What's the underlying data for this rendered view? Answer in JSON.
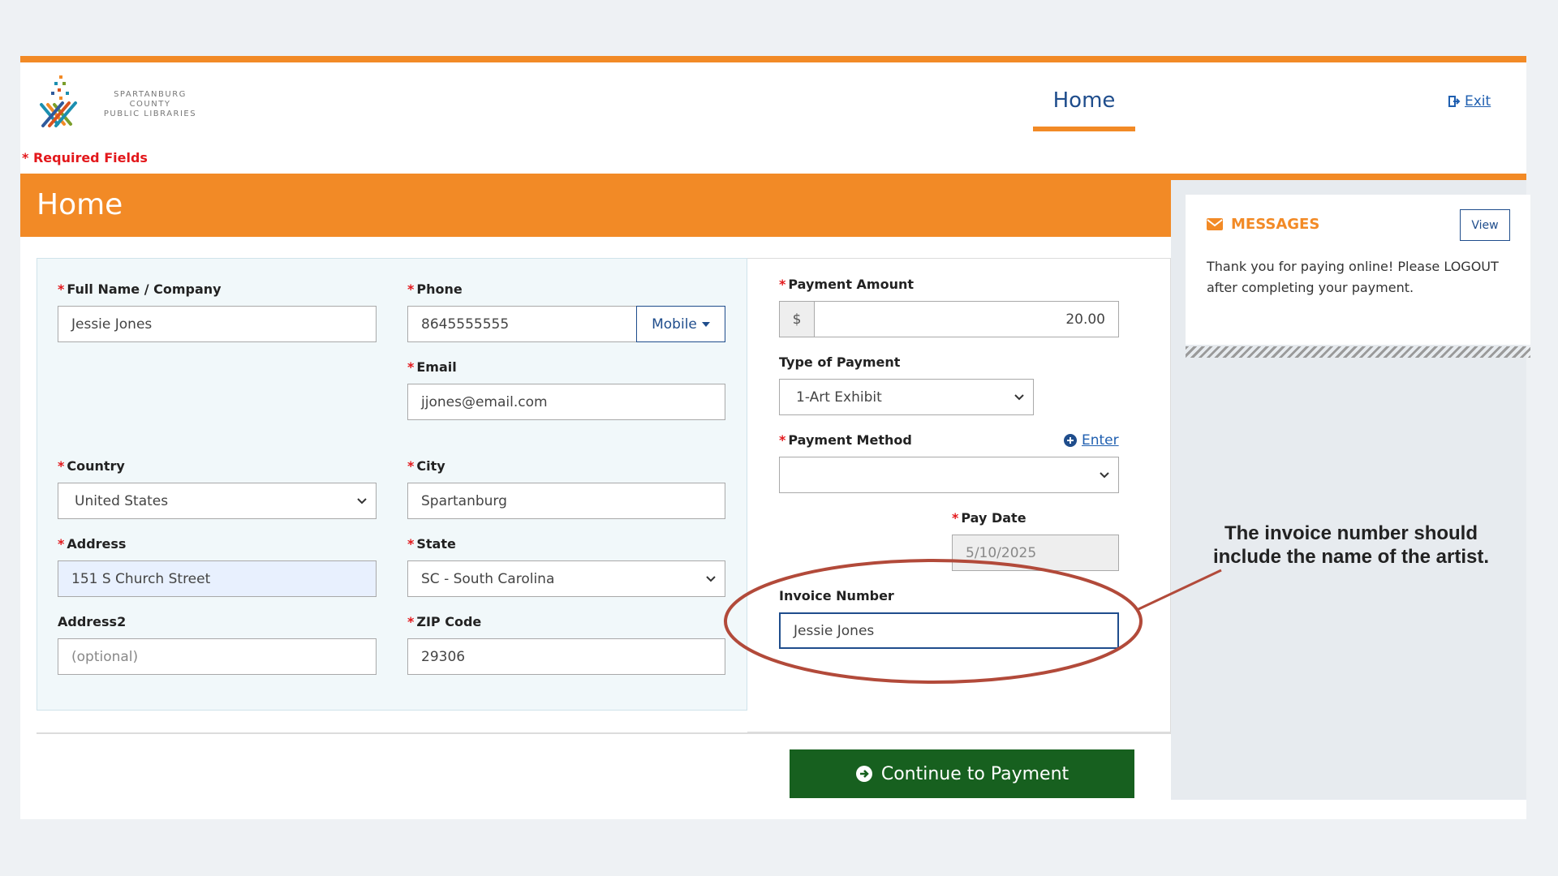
{
  "header": {
    "logo_line1": "SPARTANBURG COUNTY",
    "logo_line2": "PUBLIC LIBRARIES",
    "nav_home": "Home",
    "exit_label": "Exit"
  },
  "required_note": "* Required Fields",
  "page_title": "Home",
  "form": {
    "full_name": {
      "label": "Full Name / Company",
      "value": "Jessie Jones"
    },
    "phone": {
      "label": "Phone",
      "value": "8645555555",
      "type_button": "Mobile"
    },
    "email": {
      "label": "Email",
      "value": "jjones@email.com"
    },
    "country": {
      "label": "Country",
      "value": "United States"
    },
    "city": {
      "label": "City",
      "value": "Spartanburg"
    },
    "address": {
      "label": "Address",
      "value": "151 S Church Street"
    },
    "state": {
      "label": "State",
      "value": "SC - South Carolina"
    },
    "address2": {
      "label": "Address2",
      "placeholder": "(optional)"
    },
    "zip": {
      "label": "ZIP Code",
      "value": "29306"
    }
  },
  "payment": {
    "amount": {
      "label": "Payment Amount",
      "currency": "$",
      "value": "20.00"
    },
    "type": {
      "label": "Type of Payment",
      "value": "1-Art Exhibit"
    },
    "method": {
      "label": "Payment Method",
      "value": "",
      "enter_label": "Enter"
    },
    "pay_date": {
      "label": "Pay Date",
      "value": "5/10/2025"
    },
    "invoice": {
      "label": "Invoice Number",
      "value": "Jessie Jones"
    }
  },
  "continue_label": "Continue to Payment",
  "messages": {
    "title": "MESSAGES",
    "view_label": "View",
    "text": "Thank you for paying online! Please LOGOUT after completing your payment."
  },
  "annotation": {
    "text": "The invoice number should include the name of the artist.",
    "color": "#b24a3a"
  },
  "colors": {
    "accent": "#f28a26",
    "primary": "#1f4d8c",
    "success": "#17601f",
    "required": "#e3171b"
  }
}
